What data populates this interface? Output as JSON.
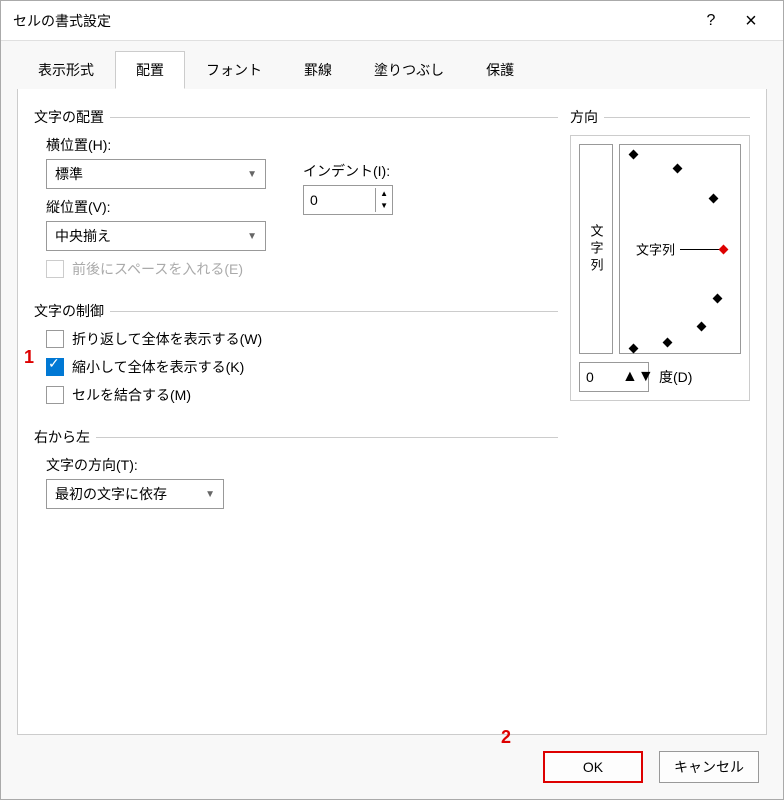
{
  "title": "セルの書式設定",
  "help_icon": "?",
  "close_icon": "×",
  "tabs": [
    "表示形式",
    "配置",
    "フォント",
    "罫線",
    "塗りつぶし",
    "保護"
  ],
  "active_tab": 1,
  "groups": {
    "text_align": "文字の配置",
    "horizontal_label": "横位置(H):",
    "horizontal_value": "標準",
    "vertical_label": "縦位置(V):",
    "vertical_value": "中央揃え",
    "space_before": "前後にスペースを入れる(E)",
    "indent_label": "インデント(I):",
    "indent_value": "0",
    "text_control": "文字の制御",
    "wrap": "折り返して全体を表示する(W)",
    "shrink": "縮小して全体を表示する(K)",
    "merge": "セルを結合する(M)",
    "rtl": "右から左",
    "text_dir_label": "文字の方向(T):",
    "text_dir_value": "最初の文字に依存"
  },
  "direction": {
    "label": "方向",
    "vert_text": "文字列",
    "wheel_text": "文字列",
    "degree_value": "0",
    "degree_label": "度(D)"
  },
  "buttons": {
    "ok": "OK",
    "cancel": "キャンセル"
  },
  "annotations": {
    "one": "1",
    "two": "2"
  }
}
